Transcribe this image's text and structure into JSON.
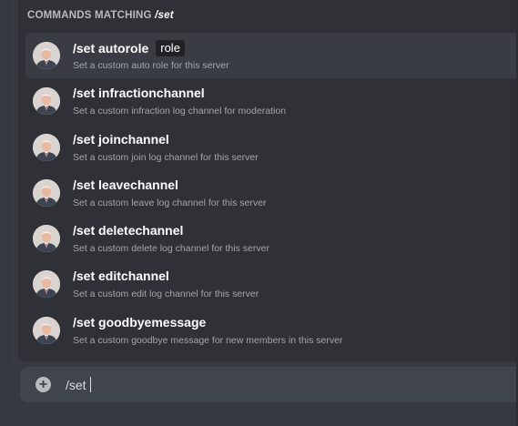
{
  "header": {
    "prefix": "COMMANDS MATCHING",
    "query": "/set"
  },
  "commands": [
    {
      "name": "/set autorole",
      "option": "role",
      "description": "Set a custom auto role for this server",
      "avatar_icon": "bot-avatar-icon"
    },
    {
      "name": "/set infractionchannel",
      "option": "",
      "description": "Set a custom infraction log channel for moderation",
      "avatar_icon": "bot-avatar-icon"
    },
    {
      "name": "/set joinchannel",
      "option": "",
      "description": "Set a custom join log channel for this server",
      "avatar_icon": "bot-avatar-icon"
    },
    {
      "name": "/set leavechannel",
      "option": "",
      "description": "Set a custom leave log channel for this server",
      "avatar_icon": "bot-avatar-icon"
    },
    {
      "name": "/set deletechannel",
      "option": "",
      "description": "Set a custom delete log channel for this server",
      "avatar_icon": "bot-avatar-icon"
    },
    {
      "name": "/set editchannel",
      "option": "",
      "description": "Set a custom edit log channel for this server",
      "avatar_icon": "bot-avatar-icon"
    },
    {
      "name": "/set goodbyemessage",
      "option": "",
      "description": "Set a custom goodbye message for new members in this server",
      "avatar_icon": "bot-avatar-icon"
    }
  ],
  "input": {
    "value": "/set",
    "attach_icon": "plus-circle-icon"
  },
  "colors": {
    "background": "#36393f",
    "panel": "#2f3136",
    "active_row": "#393c43",
    "input": "#40444b",
    "pill": "#202225"
  }
}
